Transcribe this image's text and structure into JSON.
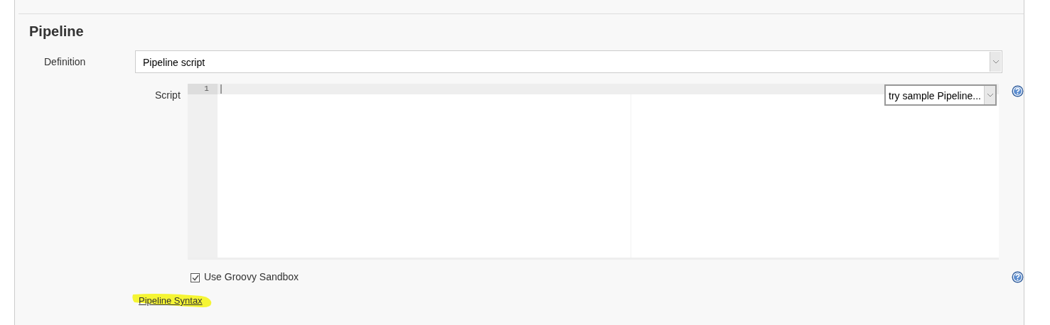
{
  "section": {
    "title": "Pipeline"
  },
  "definition": {
    "label": "Definition",
    "value": "Pipeline script"
  },
  "script": {
    "label": "Script",
    "line_numbers": [
      "1"
    ],
    "sample_select": {
      "value": "try sample Pipeline..."
    }
  },
  "sandbox": {
    "label": "Use Groovy Sandbox",
    "checked": true
  },
  "syntax_link": {
    "label": "Pipeline Syntax",
    "highlighted": true
  }
}
